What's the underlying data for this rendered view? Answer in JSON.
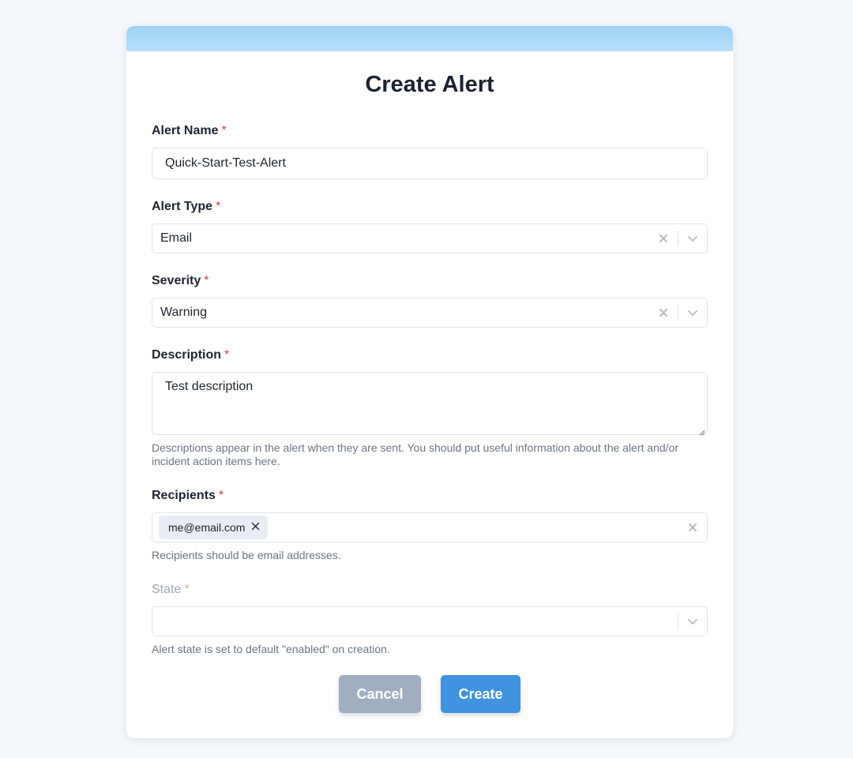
{
  "form": {
    "title": "Create Alert",
    "required_marker": "*",
    "alert_name": {
      "label": "Alert Name",
      "value": "Quick-Start-Test-Alert"
    },
    "alert_type": {
      "label": "Alert Type",
      "value": "Email"
    },
    "severity": {
      "label": "Severity",
      "value": "Warning"
    },
    "description": {
      "label": "Description",
      "value": "Test description",
      "help": "Descriptions appear in the alert when they are sent. You should put useful information about the alert and/or incident action items here."
    },
    "recipients": {
      "label": "Recipients",
      "chips": [
        "me@email.com"
      ],
      "help": "Recipients should be email addresses."
    },
    "state": {
      "label": "State",
      "value": "",
      "help": "Alert state is set to default \"enabled\" on creation."
    }
  },
  "buttons": {
    "cancel": "Cancel",
    "create": "Create"
  },
  "colors": {
    "accent": "#3f93e0",
    "cancel": "#a0aebf",
    "required": "#e0403f",
    "header_band": "#9ed1f4",
    "background": "#f4f7fb"
  },
  "icons": {
    "clear": "close-icon",
    "dropdown": "chevron-down-icon",
    "chip_remove": "close-icon",
    "textarea_resize": "resize-handle-icon"
  }
}
